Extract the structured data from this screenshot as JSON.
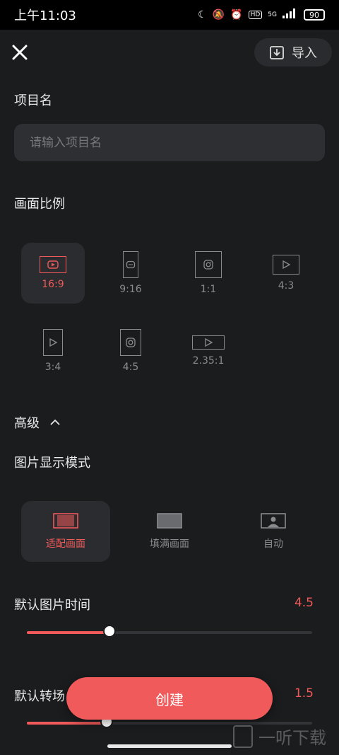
{
  "status": {
    "time": "上午11:03",
    "network": "5G",
    "battery": "90"
  },
  "header": {
    "import_label": "导入"
  },
  "project": {
    "label": "项目名",
    "placeholder": "请输入项目名"
  },
  "ratio": {
    "label": "画面比例",
    "options": [
      {
        "label": "16:9",
        "icon": "youtube-icon",
        "selected": true
      },
      {
        "label": "9:16",
        "icon": "tiktok-icon",
        "selected": false
      },
      {
        "label": "1:1",
        "icon": "instagram-icon",
        "selected": false
      },
      {
        "label": "4:3",
        "icon": "play-icon",
        "selected": false
      },
      {
        "label": "3:4",
        "icon": "play-icon",
        "selected": false
      },
      {
        "label": "4:5",
        "icon": "instagram-icon",
        "selected": false
      },
      {
        "label": "2.35:1",
        "icon": "play-icon",
        "selected": false
      }
    ]
  },
  "advanced": {
    "label": "高级"
  },
  "display_mode": {
    "label": "图片显示模式",
    "options": [
      {
        "label": "适配画面",
        "selected": true
      },
      {
        "label": "填满画面",
        "selected": false
      },
      {
        "label": "自动",
        "selected": false
      }
    ]
  },
  "image_duration": {
    "label": "默认图片时间",
    "value": "4.5",
    "progress_fraction": 0.29
  },
  "transition_duration": {
    "label": "默认转场",
    "value": "1.5",
    "progress_fraction": 0.28
  },
  "actions": {
    "create_label": "创建"
  },
  "watermark": {
    "text": "一听下载"
  },
  "colors": {
    "accent": "#f05a5a",
    "background": "#1b1c1e",
    "surface": "#2e2f33"
  }
}
